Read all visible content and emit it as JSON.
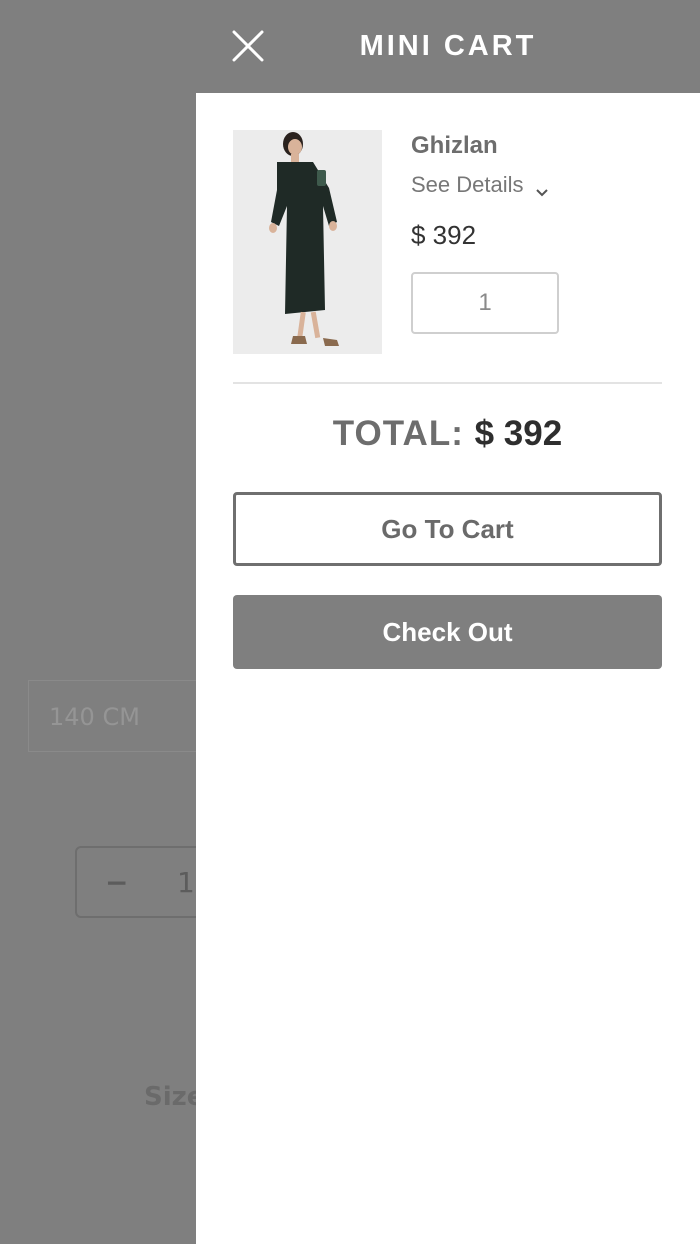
{
  "background": {
    "size_select_value": "140 CM",
    "quantity_minus": "−",
    "quantity_value": "1",
    "size_label": "Size"
  },
  "mini_cart": {
    "title": "MINI CART",
    "close_icon": "close-icon",
    "items": [
      {
        "name": "Ghizlan",
        "details_link": "See Details",
        "price": "$ 392",
        "quantity": "1"
      }
    ],
    "total_label": "TOTAL:",
    "total_value": "$ 392",
    "go_to_cart_label": "Go To Cart",
    "checkout_label": "Check Out"
  },
  "colors": {
    "overlay": "#7f7f7f",
    "header": "#7f7f7f",
    "checkout_button": "#7f7f7f",
    "text_dark": "#2e2e2e"
  }
}
